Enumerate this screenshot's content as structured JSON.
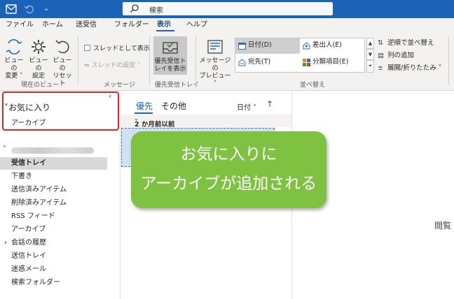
{
  "titlebar": {
    "search_placeholder": "検索",
    "icons": [
      "outlook-app-icon",
      "undo-icon",
      "quick-access-dropdown-icon",
      "search-icon"
    ]
  },
  "menu": {
    "tabs": [
      "ファイル",
      "ホーム",
      "送受信",
      "フォルダー",
      "表示",
      "ヘルプ"
    ],
    "active_tab": "表示"
  },
  "ribbon": {
    "current_view": {
      "group_label": "現在のビュー",
      "change_view_line1": "ビューの",
      "change_view_line2": "変更 ˅",
      "view_settings_line1": "ビューの",
      "view_settings_line2": "設定",
      "reset_view_line1": "ビューの",
      "reset_view_line2": "リセット"
    },
    "messages": {
      "group_label": "メッセージ",
      "show_as_conversations": "スレッドとして表示",
      "conversation_settings": "スレッドの設定 ˅"
    },
    "focused_inbox": {
      "group_label": "優先受信トレイ",
      "button_line1": "優先受信ト",
      "button_line2": "レイを表示"
    },
    "arrangement": {
      "group_label": "並べ替え",
      "preview_line1": "メッセージの",
      "preview_line2": "プレビュー ˅",
      "options": [
        "日付(D)",
        "差出人(E)",
        "宛先(T)",
        "分類項目(E)"
      ],
      "selected_option": "日付(D)",
      "reverse_sort": "逆順で並べ替え",
      "add_columns": "列の追加",
      "expand_collapse": "展開/折りたたみ ˅"
    }
  },
  "folder_pane": {
    "collapse_glyph": "‹",
    "favorites_header": "お気に入り",
    "favorites_items": [
      "アーカイブ"
    ],
    "folders": [
      "受信トレイ",
      "下書き",
      "送信済みアイテム",
      "削除済みアイテム",
      "RSS フィード",
      "アーカイブ",
      "会話の履歴",
      "送信トレイ",
      "迷惑メール",
      "検索フォルダー"
    ],
    "selected_folder": "受信トレイ"
  },
  "message_list": {
    "tab_focused": "優先",
    "tab_other": "その他",
    "sort_by": "日付",
    "sort_direction": "↑",
    "group_header": "2 か月前以前"
  },
  "callout": {
    "line1": "お気に入りに",
    "line2": "アーカイブが追加される"
  },
  "reading_pane": {
    "text": "閲覧"
  },
  "colors": {
    "titlebar": "#1c63b7",
    "highlight_border": "#e0242b",
    "callout_bg": "#7fc241",
    "accent": "#1c63b7"
  }
}
